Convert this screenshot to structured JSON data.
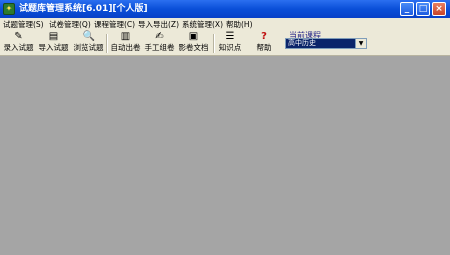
{
  "window": {
    "title": "试题库管理系统[6.01][个人版]",
    "icon": "app-logo-icon"
  },
  "titlebar_buttons": {
    "minimize": "_",
    "maximize": "□",
    "close": "×"
  },
  "menu": {
    "items": [
      {
        "label": "试题管理(S)"
      },
      {
        "label": "试卷管理(Q)"
      },
      {
        "label": "课程管理(C)"
      },
      {
        "label": "导入导出(Z)"
      },
      {
        "label": "系统管理(X)"
      },
      {
        "label": "帮助(H)"
      }
    ]
  },
  "toolbar": {
    "items": [
      {
        "label": "录入试题",
        "icon": "pencil-paper-icon",
        "glyph": "✎"
      },
      {
        "label": "导入试题",
        "icon": "import-book-icon",
        "glyph": "▤"
      },
      {
        "label": "浏览试题",
        "icon": "magnifier-icon",
        "glyph": "🔍"
      },
      {
        "label": "自动出卷",
        "icon": "printer-icon",
        "glyph": "▥"
      },
      {
        "label": "手工组卷",
        "icon": "hand-edit-icon",
        "glyph": "✍"
      },
      {
        "label": "影卷文档",
        "icon": "document-icon",
        "glyph": "▣"
      },
      {
        "label": "知识点",
        "icon": "knowledge-list-icon",
        "glyph": "☰"
      },
      {
        "label": "帮助",
        "icon": "help-icon",
        "glyph": "?"
      }
    ]
  },
  "course": {
    "label": "当前课程",
    "value": "高中历史",
    "dropdown_glyph": "▼"
  },
  "colors": {
    "titlebar": "#0a4fd8",
    "chrome": "#ece9d8",
    "workspace": "#a5a5a5"
  }
}
